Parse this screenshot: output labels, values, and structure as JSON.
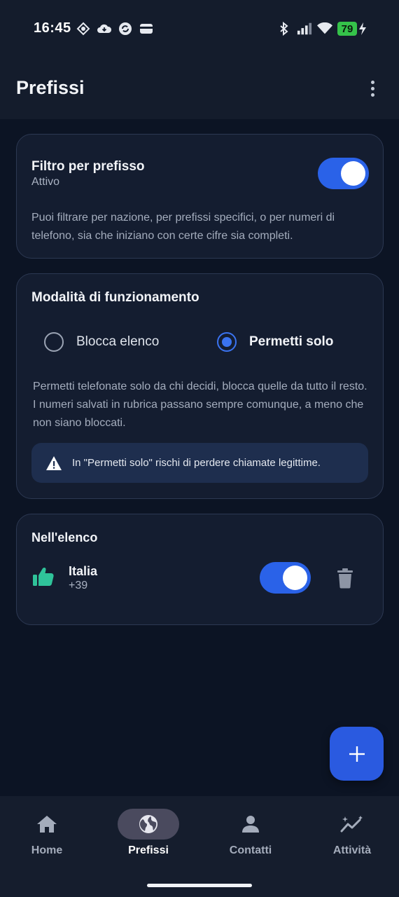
{
  "status_bar": {
    "time": "16:45",
    "battery": "79",
    "icons_left": [
      "gauge-icon",
      "cloud-icon",
      "sync-icon",
      "wallet-icon"
    ],
    "icons_right": [
      "bluetooth-icon",
      "signal-icon",
      "wifi-icon",
      "battery-icon",
      "charging-icon"
    ]
  },
  "app_bar": {
    "title": "Prefissi",
    "menu_icon": "more-vertical-icon"
  },
  "filter_card": {
    "title": "Filtro per prefisso",
    "status": "Attivo",
    "enabled": true,
    "description": "Puoi filtrare per nazione, per prefissi specifici, o per numeri di telefono, sia che iniziano con certe cifre sia completi."
  },
  "mode_card": {
    "title": "Modalità di funzionamento",
    "options": [
      {
        "label": "Blocca elenco",
        "selected": false
      },
      {
        "label": "Permetti solo",
        "selected": true
      }
    ],
    "description": "Permetti telefonate solo da chi decidi, blocca quelle da tutto il resto. I numeri salvati in rubrica passano sempre comunque, a meno che non siano bloccati.",
    "warning": "In \"Permetti solo\" rischi di perdere chiamate legittime."
  },
  "list_card": {
    "title": "Nell'elenco",
    "items": [
      {
        "name": "Italia",
        "code": "+39",
        "enabled": true,
        "icon": "thumbs-up-icon"
      }
    ]
  },
  "fab": {
    "icon": "plus-icon"
  },
  "bottom_nav": {
    "items": [
      {
        "label": "Home",
        "icon": "home-icon",
        "active": false
      },
      {
        "label": "Prefissi",
        "icon": "globe-icon",
        "active": true
      },
      {
        "label": "Contatti",
        "icon": "person-icon",
        "active": false
      },
      {
        "label": "Attività",
        "icon": "activity-icon",
        "active": false
      }
    ]
  },
  "colors": {
    "background": "#0c1424",
    "surface": "#141d30",
    "accent": "#2a62e8",
    "positive": "#2fc39a",
    "warning_bg": "#1e2e4e"
  }
}
